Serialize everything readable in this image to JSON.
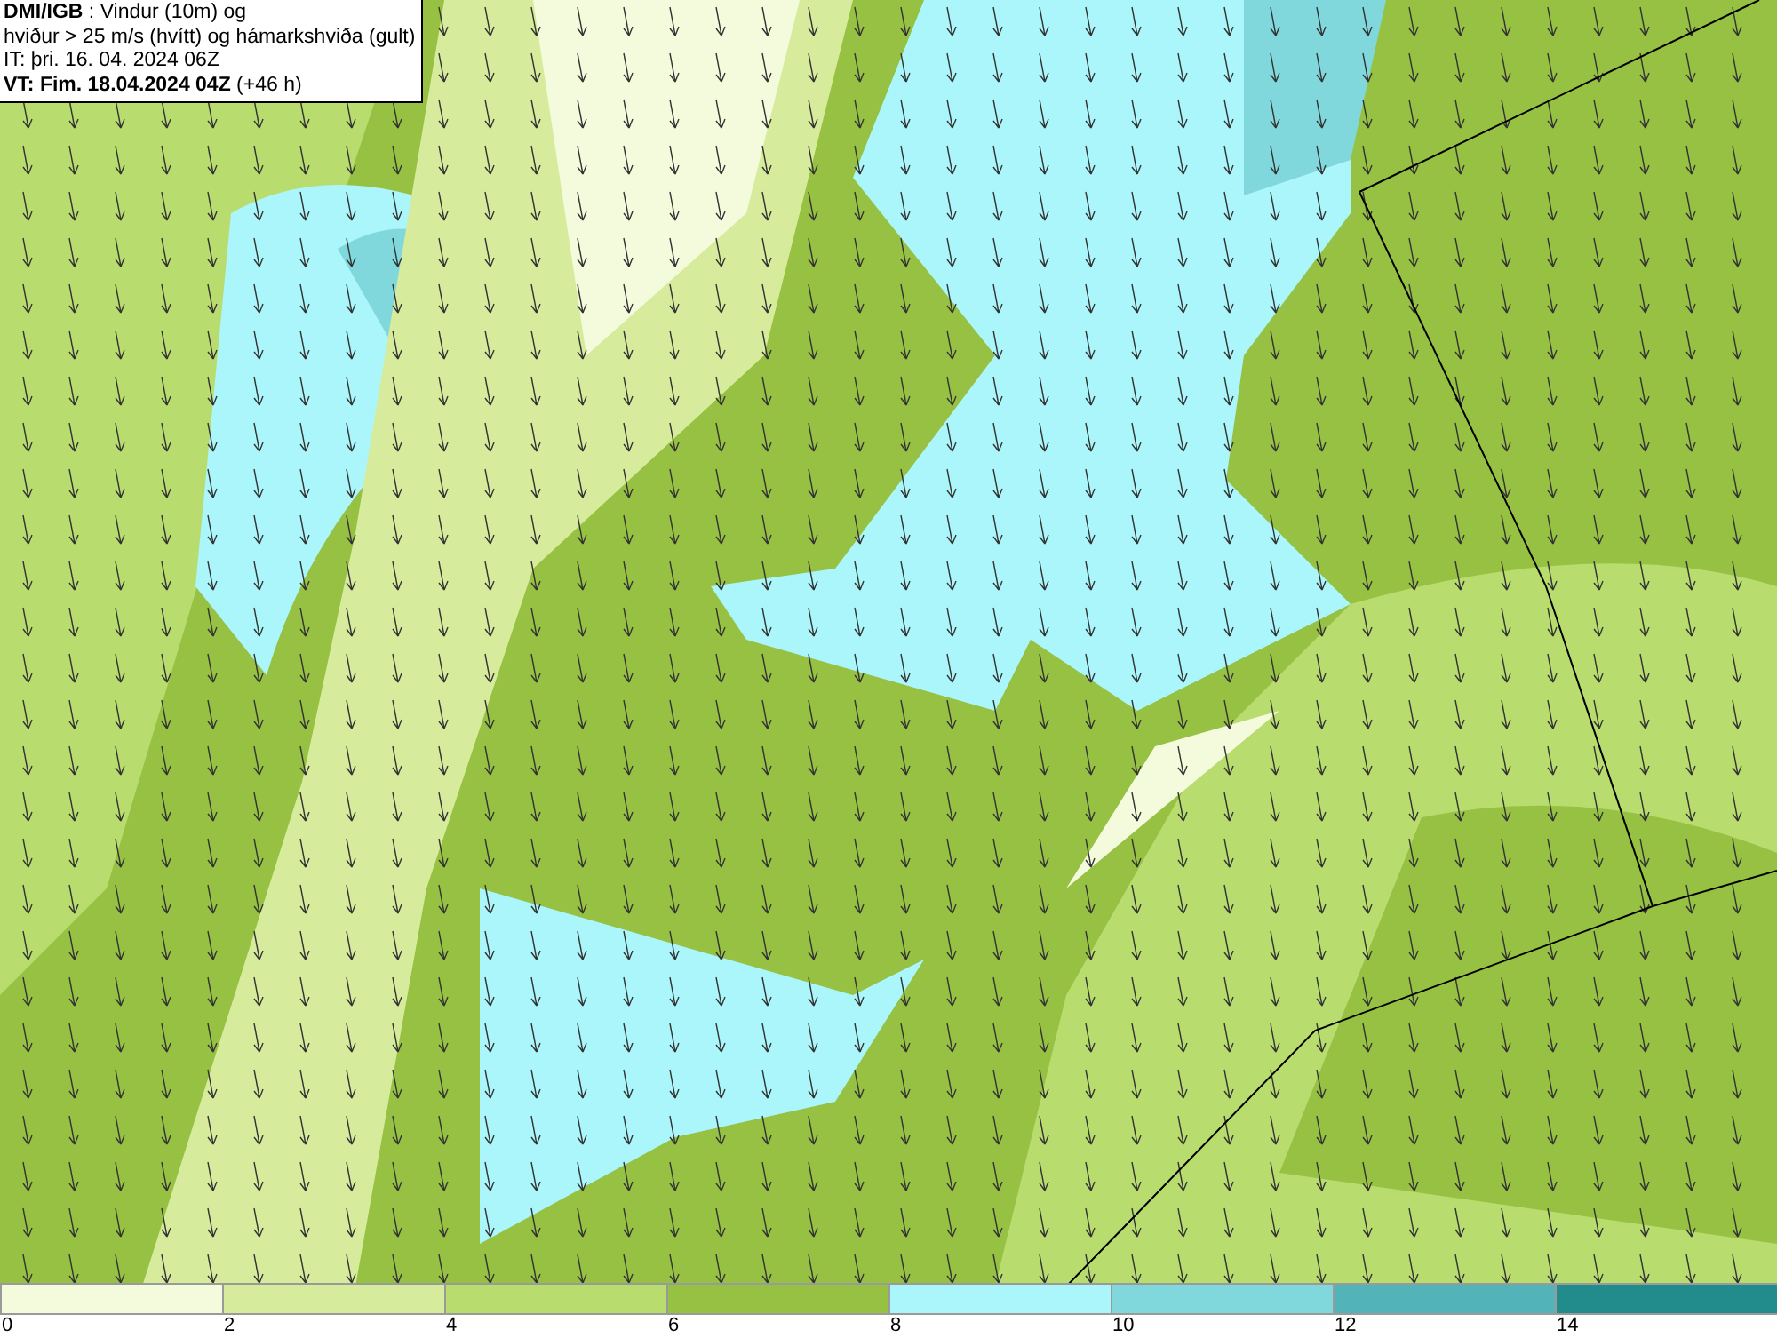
{
  "header": {
    "lines": [
      "**DMI/IGB** : Vindur (10m) og",
      "hviður > 25 m/s (hvítt) og hámarkshviða (gult)",
      "IT: þri. 16. 04. 2024 06Z",
      "**VT: Fim. 18.04.2024 04Z** (+46 h)"
    ]
  },
  "legend": [
    {
      "label": "0",
      "color": "#f3fbdc"
    },
    {
      "label": "2",
      "color": "#d6ec9c"
    },
    {
      "label": "4",
      "color": "#b8dc6e"
    },
    {
      "label": "6",
      "color": "#96c142"
    },
    {
      "label": "8",
      "color": "#aaf6fb"
    },
    {
      "label": "10",
      "color": "#80d8dc"
    },
    {
      "label": "12",
      "color": "#52b4b8"
    },
    {
      "label": "14",
      "color": "#228c8c"
    }
  ]
}
